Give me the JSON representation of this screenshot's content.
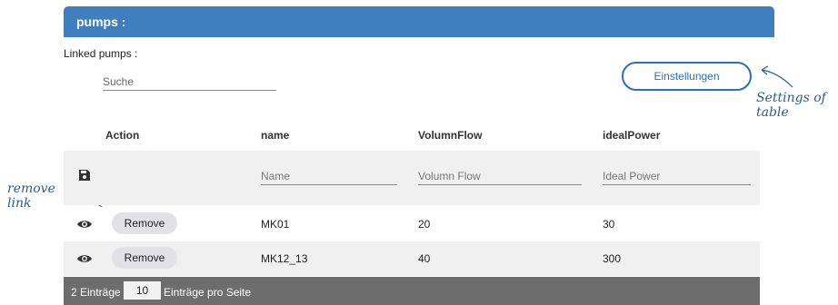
{
  "panel": {
    "title": "pumps :"
  },
  "linked_label": "Linked pumps :",
  "search": {
    "placeholder": "Suche",
    "value": ""
  },
  "settings_button": {
    "label": "Einstellungen"
  },
  "annotations": {
    "settings": "Settings of table",
    "remove": "remove link"
  },
  "table": {
    "headers": [
      "Action",
      "name",
      "VolumnFlow",
      "idealPower"
    ],
    "filters": {
      "name_placeholder": "Name",
      "flow_placeholder": "Volumn Flow",
      "power_placeholder": "Ideal Power"
    },
    "rows": [
      {
        "action": "Remove",
        "name": "MK01",
        "flow": "20",
        "power": "30"
      },
      {
        "action": "Remove",
        "name": "MK12_13",
        "flow": "40",
        "power": "300"
      }
    ]
  },
  "footer": {
    "count_text": "2 Einträge",
    "per_page_value": "10",
    "per_page_text": "Einträge pro Seite"
  },
  "icons": {
    "save": "save-icon",
    "view": "eye-icon"
  },
  "colors": {
    "header": "#3f7fbf",
    "accent": "#2e6fb0",
    "footer": "#6d6d6d",
    "annotation": "#2c5d8a"
  }
}
